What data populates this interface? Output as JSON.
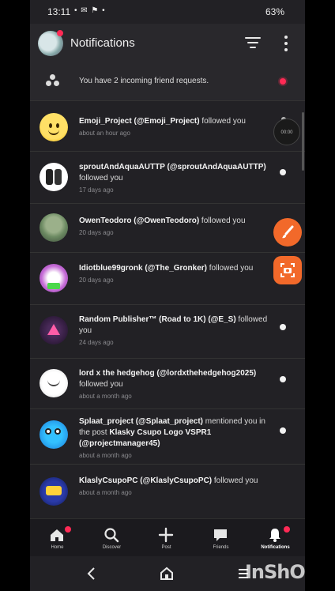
{
  "status_bar": {
    "time": "13:11",
    "left_icons": "• ✉ ⚑ •",
    "right_icons": "🔇 ≡ ▂▄▆",
    "battery": "63%"
  },
  "header": {
    "title": "Notifications"
  },
  "friend_requests": {
    "text": "You have 2 incoming friend requests."
  },
  "notifications": [
    {
      "name": "Emoji_Project (@Emoji_Project)",
      "action": " followed you",
      "time": "about an hour ago",
      "avatar_icon": "smiley-avatar"
    },
    {
      "name": "sproutAndAquaAUTTP (@sproutAndAquaAUTTP)",
      "action": " followed you",
      "time": "17 days ago",
      "avatar_icon": "phones-avatar"
    },
    {
      "name": "OwenTeodoro (@OwenTeodoro)",
      "action": " followed you",
      "time": "20 days ago",
      "avatar_icon": "character-avatar"
    },
    {
      "name": "Idiotblue99gronk (@The_Gronker)",
      "action": " followed you",
      "time": "20 days ago",
      "avatar_icon": "gronk-avatar"
    },
    {
      "name": "Random Publisher™ (Road to 1K) (@E_S)",
      "action": " followed you",
      "time": "24 days ago",
      "avatar_icon": "triangle-avatar"
    },
    {
      "name": "lord x the hedgehog (@lordxthehedgehog2025)",
      "action": " followed you",
      "time": "about a month ago",
      "avatar_icon": "lord-avatar"
    },
    {
      "name": "Splaat_project (@Splaat_project)",
      "action": " mentioned you in the post ",
      "post": "Klasky Csupo Logo VSPR1 (@projectmanager45)",
      "time": "about a month ago",
      "avatar_icon": "splaat-avatar"
    },
    {
      "name": "KlaslyCsupoPC (@KlaslyCsupoPC)",
      "action": " followed you",
      "time": "about a month ago",
      "avatar_icon": "klasky-avatar"
    }
  ],
  "overlay": {
    "timer_label": "00:00"
  },
  "bottom_nav": [
    {
      "label": "Home",
      "icon": "home-icon",
      "badge": true
    },
    {
      "label": "Discover",
      "icon": "search-icon",
      "badge": false
    },
    {
      "label": "Post",
      "icon": "plus-icon",
      "badge": false
    },
    {
      "label": "Friends",
      "icon": "chat-icon",
      "badge": false
    },
    {
      "label": "Notifications",
      "icon": "bell-icon",
      "badge": true,
      "active": true
    }
  ],
  "watermark": "InShOt",
  "colors": {
    "background": "#222125",
    "header": "#29282c",
    "unread_accent": "#ff2a55",
    "floating_button": "#f2692a"
  }
}
